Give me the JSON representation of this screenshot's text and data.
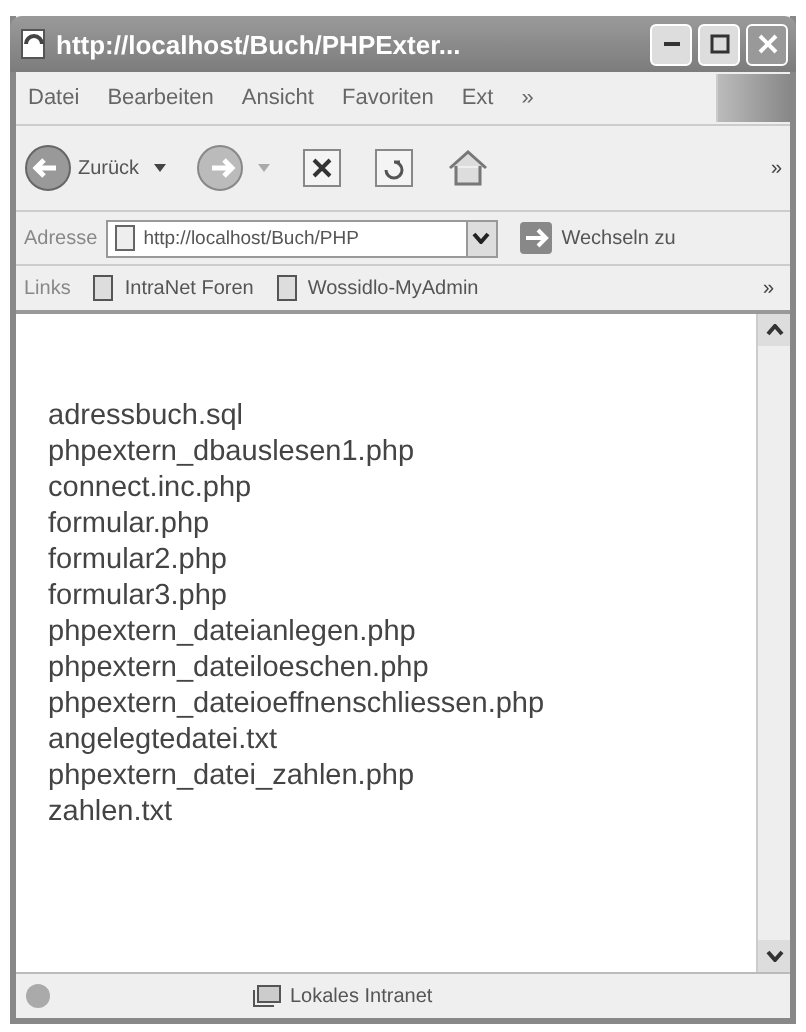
{
  "window": {
    "title": "http://localhost/Buch/PHPExter..."
  },
  "menu": [
    "Datei",
    "Bearbeiten",
    "Ansicht",
    "Favoriten",
    "Ext",
    "»"
  ],
  "toolbar": {
    "back_label": "Zurück",
    "more": "»"
  },
  "address": {
    "label": "Adresse",
    "value": "http://localhost/Buch/PHP",
    "go_label": "Wechseln zu"
  },
  "links": {
    "label": "Links",
    "items": [
      "IntraNet Foren",
      "Wossidlo-MyAdmin"
    ],
    "more": "»"
  },
  "files": [
    "adressbuch.sql",
    "phpextern_dbauslesen1.php",
    "connect.inc.php",
    "formular.php",
    "formular2.php",
    "formular3.php",
    "phpextern_dateianlegen.php",
    "phpextern_dateiloeschen.php",
    "phpextern_dateioeffnenschliessen.php",
    "angelegtedatei.txt",
    "phpextern_datei_zahlen.php",
    "zahlen.txt"
  ],
  "status_bar": {
    "zone": "Lokales Intranet"
  }
}
